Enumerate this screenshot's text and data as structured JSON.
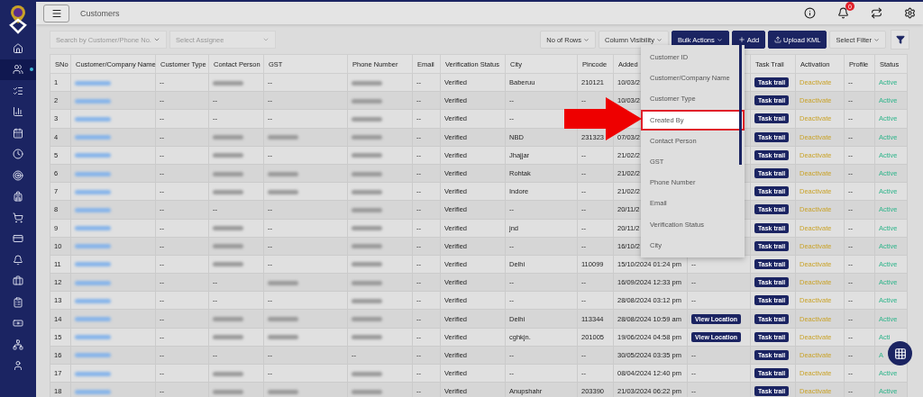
{
  "sidebar": {
    "items": [
      {
        "kind": "home",
        "selected": false,
        "dot": false
      },
      {
        "kind": "users",
        "selected": true,
        "dot": true
      },
      {
        "kind": "list",
        "selected": false,
        "dot": false
      },
      {
        "kind": "chart",
        "selected": false,
        "dot": false
      },
      {
        "kind": "calendar",
        "selected": false,
        "dot": false
      },
      {
        "kind": "clock",
        "selected": false,
        "dot": false
      },
      {
        "kind": "target",
        "selected": false,
        "dot": false
      },
      {
        "kind": "bag",
        "selected": false,
        "dot": false
      },
      {
        "kind": "cart",
        "selected": false,
        "dot": false
      },
      {
        "kind": "card",
        "selected": false,
        "dot": false
      },
      {
        "kind": "bell",
        "selected": false,
        "dot": false
      },
      {
        "kind": "briefcase",
        "selected": false,
        "dot": false
      },
      {
        "kind": "clipboard",
        "selected": false,
        "dot": false
      },
      {
        "kind": "money",
        "selected": false,
        "dot": false
      },
      {
        "kind": "network",
        "selected": false,
        "dot": false
      },
      {
        "kind": "user",
        "selected": false,
        "dot": false
      }
    ]
  },
  "header": {
    "title": "Customers",
    "notification_count": "0"
  },
  "toolbar": {
    "search": {
      "placeholder": "Search by Customer/Phone No."
    },
    "assignee": {
      "placeholder": "Select Assignee"
    },
    "buttons": [
      {
        "kind": "outline",
        "label": "No of Rows"
      },
      {
        "kind": "outline",
        "label": "Column Visibility"
      },
      {
        "kind": "primary",
        "label": "Bulk Actions"
      },
      {
        "kind": "primary",
        "label": "Add"
      },
      {
        "kind": "primary",
        "label": "Upload KML"
      },
      {
        "kind": "outline",
        "label": "Select Filter"
      }
    ]
  },
  "table": {
    "columns": [
      {
        "label": "SNo"
      },
      {
        "label": "Customer/Company Name"
      },
      {
        "label": "Customer Type"
      },
      {
        "label": "Contact Person"
      },
      {
        "label": "GST"
      },
      {
        "label": "Phone Number"
      },
      {
        "label": "Email"
      },
      {
        "label": "Verification Status"
      },
      {
        "label": "City"
      },
      {
        "label": "Pincode"
      },
      {
        "label": "Added"
      },
      {},
      {
        "label": "Task Trail"
      },
      {
        "label": "Activation"
      },
      {
        "label": "Profile"
      },
      {
        "label": "Status"
      }
    ],
    "rows": [
      {
        "cells": [
          "1",
          {
            "kind": "redacted"
          },
          "--",
          {
            "kind": "redacted"
          },
          "--",
          {
            "kind": "redacted"
          },
          "--",
          "Verified",
          "Baberuu",
          "210121",
          "10/03/2",
          null,
          "Task trail",
          "Deactivate",
          "--",
          "Active"
        ]
      },
      {
        "cells": [
          "2",
          {
            "kind": "redacted"
          },
          "--",
          "--",
          "--",
          {
            "kind": "redacted"
          },
          "--",
          "Verified",
          "--",
          "--",
          "10/03/2",
          null,
          "Task trail",
          "Deactivate",
          "--",
          "Active"
        ]
      },
      {
        "cells": [
          "3",
          {
            "kind": "redacted"
          },
          "--",
          "--",
          "--",
          {
            "kind": "redacted"
          },
          "--",
          "Verified",
          "--",
          null,
          null,
          null,
          "Task trail",
          "Deactivate",
          "--",
          "Active"
        ]
      },
      {
        "cells": [
          "4",
          {
            "kind": "redacted"
          },
          "--",
          {
            "kind": "redacted"
          },
          {
            "kind": "redacted"
          },
          {
            "kind": "redacted"
          },
          "--",
          "Verified",
          "NBD",
          "231323",
          "07/03/2",
          null,
          "Task trail",
          "Deactivate",
          "--",
          "Active"
        ]
      },
      {
        "cells": [
          "5",
          {
            "kind": "redacted"
          },
          "--",
          {
            "kind": "redacted"
          },
          "--",
          {
            "kind": "redacted"
          },
          "--",
          "Verified",
          "Jhajjar",
          "--",
          "21/02/2",
          null,
          "Task trail",
          "Deactivate",
          "--",
          "Active"
        ]
      },
      {
        "cells": [
          "6",
          {
            "kind": "redacted"
          },
          "--",
          {
            "kind": "redacted"
          },
          {
            "kind": "redacted"
          },
          {
            "kind": "redacted"
          },
          "--",
          "Verified",
          "Rohtak",
          "--",
          "21/02/2",
          null,
          "Task trail",
          "Deactivate",
          "--",
          "Active"
        ]
      },
      {
        "cells": [
          "7",
          {
            "kind": "redacted"
          },
          "--",
          {
            "kind": "redacted"
          },
          {
            "kind": "redacted"
          },
          {
            "kind": "redacted"
          },
          "--",
          "Verified",
          "Indore",
          "--",
          "21/02/2",
          null,
          "Task trail",
          "Deactivate",
          "--",
          "Active"
        ]
      },
      {
        "cells": [
          "8",
          {
            "kind": "redacted"
          },
          "--",
          "--",
          "--",
          {
            "kind": "redacted"
          },
          "--",
          "Verified",
          "--",
          "--",
          "20/11/2",
          null,
          "Task trail",
          "Deactivate",
          "--",
          "Active"
        ]
      },
      {
        "cells": [
          "9",
          {
            "kind": "redacted"
          },
          "--",
          {
            "kind": "redacted"
          },
          "--",
          {
            "kind": "redacted"
          },
          "--",
          "Verified",
          "jnd",
          "--",
          "20/11/2",
          null,
          "Task trail",
          "Deactivate",
          "--",
          "Active"
        ]
      },
      {
        "cells": [
          "10",
          {
            "kind": "redacted"
          },
          "--",
          {
            "kind": "redacted"
          },
          "--",
          {
            "kind": "redacted"
          },
          "--",
          "Verified",
          "--",
          "--",
          "16/10/2",
          null,
          "Task trail",
          "Deactivate",
          "--",
          "Active"
        ]
      },
      {
        "cells": [
          "11",
          {
            "kind": "redacted"
          },
          "--",
          {
            "kind": "redacted"
          },
          "--",
          {
            "kind": "redacted"
          },
          "--",
          "Verified",
          "Delhi",
          "110099",
          "15/10/2024 01:24 pm",
          "--",
          "Task trail",
          "Deactivate",
          "--",
          "Active"
        ]
      },
      {
        "cells": [
          "12",
          {
            "kind": "redacted"
          },
          "--",
          "--",
          {
            "kind": "redacted"
          },
          {
            "kind": "redacted"
          },
          "--",
          "Verified",
          "--",
          "--",
          "16/09/2024 12:33 pm",
          "--",
          "Task trail",
          "Deactivate",
          "--",
          "Active"
        ]
      },
      {
        "cells": [
          "13",
          {
            "kind": "redacted"
          },
          "--",
          "--",
          "--",
          {
            "kind": "redacted"
          },
          "--",
          "Verified",
          "--",
          "--",
          "28/08/2024 03:12 pm",
          "--",
          "Task trail",
          "Deactivate",
          "--",
          "Active"
        ]
      },
      {
        "cells": [
          "14",
          {
            "kind": "redacted"
          },
          "--",
          {
            "kind": "redacted"
          },
          {
            "kind": "redacted"
          },
          {
            "kind": "redacted"
          },
          "--",
          "Verified",
          "Delhi",
          "113344",
          "28/08/2024 10:59 am",
          {
            "kind": "button",
            "label": "View Location"
          },
          "Task trail",
          "Deactivate",
          "--",
          "Active"
        ]
      },
      {
        "cells": [
          "15",
          {
            "kind": "redacted"
          },
          "--",
          {
            "kind": "redacted"
          },
          {
            "kind": "redacted"
          },
          {
            "kind": "redacted"
          },
          "--",
          "Verified",
          "cghkjn.",
          "201005",
          "19/06/2024 04:58 pm",
          {
            "kind": "button",
            "label": "View Location"
          },
          "Task trail",
          "Deactivate",
          "--",
          "Acti"
        ]
      },
      {
        "cells": [
          "16",
          {
            "kind": "redacted"
          },
          "--",
          "--",
          "--",
          "--",
          "--",
          "Verified",
          "--",
          "--",
          "30/05/2024 03:35 pm",
          "--",
          "Task trail",
          "Deactivate",
          "--",
          "A"
        ]
      },
      {
        "cells": [
          "17",
          {
            "kind": "redacted"
          },
          "--",
          {
            "kind": "redacted"
          },
          "--",
          {
            "kind": "redacted"
          },
          "--",
          "Verified",
          "--",
          "--",
          "08/04/2024 12:40 pm",
          "--",
          "Task trail",
          "Deactivate",
          "--",
          "Active"
        ]
      },
      {
        "cells": [
          "18",
          {
            "kind": "redacted"
          },
          "--",
          {
            "kind": "redacted"
          },
          {
            "kind": "redacted"
          },
          {
            "kind": "redacted"
          },
          "--",
          "Verified",
          "Anupshahr",
          "203390",
          "21/03/2024 06:22 pm",
          "--",
          "Task trail",
          "Deactivate",
          "--",
          "Active"
        ]
      }
    ]
  },
  "column_menu": {
    "items": [
      {
        "label": "Customer ID",
        "highlighted": false
      },
      {
        "label": "Customer/Company Name",
        "highlighted": false
      },
      {
        "label": "Customer Type",
        "highlighted": false
      },
      {
        "label": "Created By",
        "highlighted": true
      },
      {
        "label": "Contact Person",
        "highlighted": false
      },
      {
        "label": "GST",
        "highlighted": false
      },
      {
        "label": "Phone Number",
        "highlighted": false
      },
      {
        "label": "Email",
        "highlighted": false
      },
      {
        "label": "Verification Status",
        "highlighted": false
      },
      {
        "label": "City",
        "highlighted": false
      }
    ]
  }
}
